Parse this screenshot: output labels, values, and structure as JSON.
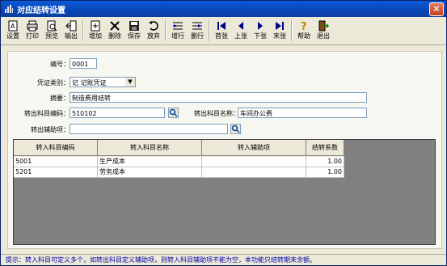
{
  "window": {
    "title": "对应结转设置",
    "close_label": "×"
  },
  "toolbar": {
    "buttons": [
      {
        "label": "设置",
        "icon": "settings-icon"
      },
      {
        "label": "打印",
        "icon": "printer-icon"
      },
      {
        "label": "预览",
        "icon": "preview-icon"
      },
      {
        "label": "输出",
        "icon": "export-icon"
      },
      {
        "label": "增加",
        "icon": "add-icon"
      },
      {
        "label": "删除",
        "icon": "delete-icon"
      },
      {
        "label": "保存",
        "icon": "save-icon"
      },
      {
        "label": "放弃",
        "icon": "undo-icon"
      },
      {
        "label": "增行",
        "icon": "insert-row-icon"
      },
      {
        "label": "删行",
        "icon": "delete-row-icon"
      },
      {
        "label": "首张",
        "icon": "first-icon"
      },
      {
        "label": "上张",
        "icon": "prev-icon"
      },
      {
        "label": "下张",
        "icon": "next-icon"
      },
      {
        "label": "末张",
        "icon": "last-icon"
      },
      {
        "label": "帮助",
        "icon": "help-icon"
      },
      {
        "label": "退出",
        "icon": "exit-icon"
      }
    ]
  },
  "form": {
    "number_label": "编号：",
    "number_value": "0001",
    "voucher_type_label": "凭证类别：",
    "voucher_type_value": "记   记账凭证",
    "summary_label": "摘要：",
    "summary_value": "制造费用结转",
    "out_code_label": "转出科目编码：",
    "out_code_value": "510102",
    "out_name_label": "转出科目名称：",
    "out_name_value": "车间办公费",
    "out_aux_label": "转出辅助项：",
    "out_aux_value": ""
  },
  "grid": {
    "headers": [
      "转入科目编码",
      "转入科目名称",
      "转入辅助项",
      "结转系数"
    ],
    "rows": [
      [
        "5001",
        "生产成本",
        "",
        "1.00"
      ],
      [
        "5201",
        "劳务成本",
        "",
        "1.00"
      ]
    ]
  },
  "status": {
    "hint": "提示：转入科目可定义多个，如转出科目定义辅助项，则转入科目辅助项不能为空，本功能只结转期末余额。"
  },
  "colors": {
    "title_bar": "#0a5ad8",
    "grid_bg": "#808080",
    "hint_text": "#0000aa"
  }
}
